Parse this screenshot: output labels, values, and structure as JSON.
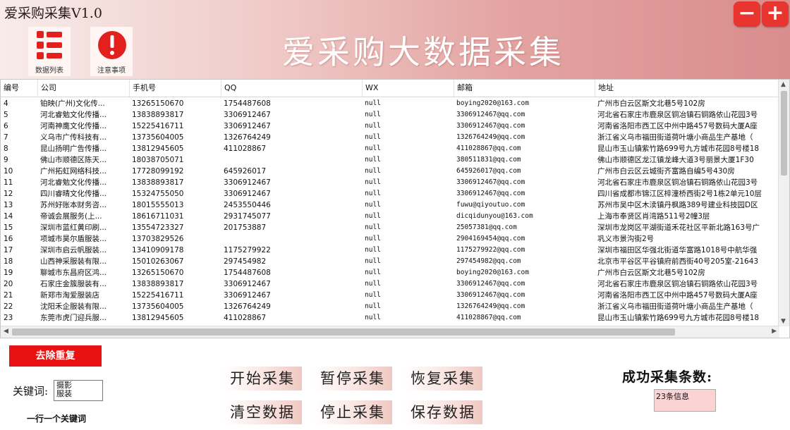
{
  "app": {
    "title": "爱采购采集V1.0",
    "banner_title": "爱采购大数据采集",
    "minimize_glyph": "−",
    "expand_glyph": "+",
    "tiles": [
      {
        "label": "数据列表",
        "icon": "list-icon"
      },
      {
        "label": "注意事项",
        "icon": "warning-icon"
      }
    ]
  },
  "grid": {
    "columns": [
      "编号",
      "公司",
      "手机号",
      "QQ",
      "WX",
      "邮箱",
      "地址"
    ],
    "rows": [
      [
        "4",
        "铂映(广州)文化传...",
        "13265150670",
        "1754487608",
        "null",
        "boying2020@163.com",
        "广州市白云区斯文北巷5号102房"
      ],
      [
        "5",
        "河北睿勉文化传播...",
        "13838893817",
        "3306912467",
        "null",
        "3306912467@qq.com",
        "河北省石家庄市鹿泉区铜冶镇石铜路依山花园3号"
      ],
      [
        "6",
        "河南神鹰文化传播...",
        "15225416711",
        "3306912467",
        "null",
        "3306912467@qq.com",
        "河南省洛阳市西工区中州中路457号数码大厦A座"
      ],
      [
        "7",
        "义乌市广传科技有...",
        "13735604005",
        "1326764249",
        "null",
        "1326764249@qq.com",
        "浙江省义乌市福田街道荷叶塘小商品生产基地（"
      ],
      [
        "8",
        "昆山扬明广告传播...",
        "13812945605",
        "411028867",
        "null",
        "411028867@qq.com",
        "昆山市玉山镇紫竹路699号九方城市花园8号楼18"
      ],
      [
        "9",
        "佛山市顺德区陈天...",
        "18038705071",
        "",
        "null",
        "380511831@qq.com",
        "佛山市顺德区龙江镇龙峰大道3号丽景大厦1F30"
      ],
      [
        "10",
        "广州拓虹网络科技...",
        "17728099192",
        "645926017",
        "null",
        "645926017@qq.com",
        "广州市白云区云城街齐富路自编5号430房"
      ],
      [
        "11",
        "河北睿勉文化传播...",
        "13838893817",
        "3306912467",
        "null",
        "3306912467@qq.com",
        "河北省石家庄市鹿泉区铜冶镇石铜路依山花园3号"
      ],
      [
        "12",
        "四川睿晴文化传播...",
        "15324755050",
        "3306912467",
        "null",
        "3306912467@qq.com",
        "四川省成都市锦江区椊潼桥西街2号1栋2单元10层"
      ],
      [
        "13",
        "苏州好账本财务咨...",
        "18015555013",
        "2453550446",
        "null",
        "fuwu@qiyoutuo.com",
        "苏州市吴中区木渎镇丹枫路389号建业科技园D区"
      ],
      [
        "14",
        "帝诚会展服务(上...",
        "18616711031",
        "2931745077",
        "null",
        "dicqidunyou@163.com",
        "上海市奉贤区肖湾路511号2幢3层"
      ],
      [
        "15",
        "深圳市蓝红黄印刷...",
        "13554723327",
        "201753887",
        "null",
        "25057381@qq.com",
        "深圳市龙岗区平湖街道禾花社区平新北路163号广"
      ],
      [
        "16",
        "项城市昊尔盾服装...",
        "13703829526",
        "",
        "null",
        "2904169454@qq.com",
        "巩义市景沟街2号"
      ],
      [
        "17",
        "深圳市启云帆服装...",
        "13410909178",
        "1175279922",
        "null",
        "1175279922@qq.com",
        "深圳市福田区华强北街道华富路1018号中航华强"
      ],
      [
        "18",
        "山西神采服装有限...",
        "15010263067",
        "297454982",
        "null",
        "297454982@qq.com",
        "北京市平谷区平谷镇府前西街40号205室-21643"
      ],
      [
        "19",
        "聊城市东昌府区鸿...",
        "13265150670",
        "1754487608",
        "null",
        "boying2020@163.com",
        "广州市白云区斯文北巷5号102房"
      ],
      [
        "20",
        "石家庄金簇服装有...",
        "13838893817",
        "3306912467",
        "null",
        "3306912467@qq.com",
        "河北省石家庄市鹿泉区铜冶镇石铜路依山花园3号"
      ],
      [
        "21",
        "新郑市淘爱服装店",
        "15225416711",
        "3306912467",
        "null",
        "3306912467@qq.com",
        "河南省洛阳市西工区中州中路457号数码大厦A座"
      ],
      [
        "22",
        "沈阳禾企服装有限...",
        "13735604005",
        "1326764249",
        "null",
        "1326764249@qq.com",
        "浙江省义乌市福田街道荷叶塘小商品生产基地（"
      ],
      [
        "23",
        "东莞市虎门迎兵服...",
        "13812945605",
        "411028867",
        "null",
        "411028867@qq.com",
        "昆山市玉山镇紫竹路699号九方城市花园8号楼18"
      ]
    ]
  },
  "controls": {
    "dedupe_label": "去除重复",
    "keyword_label": "关键词:",
    "keyword_value": "摄影\n服装",
    "keyword_hint": "一行一个关键词",
    "start_label": "开始采集",
    "pause_label": "暂停采集",
    "resume_label": "恢复采集",
    "clear_label": "清空数据",
    "stop_label": "停止采集",
    "save_label": "保存数据",
    "count_label": "成功采集条数:",
    "count_value": "23条信息"
  },
  "colors": {
    "accent_red": "#e81212",
    "window_button_red": "#e8352f",
    "count_box_bg": "#fbd3d3"
  }
}
